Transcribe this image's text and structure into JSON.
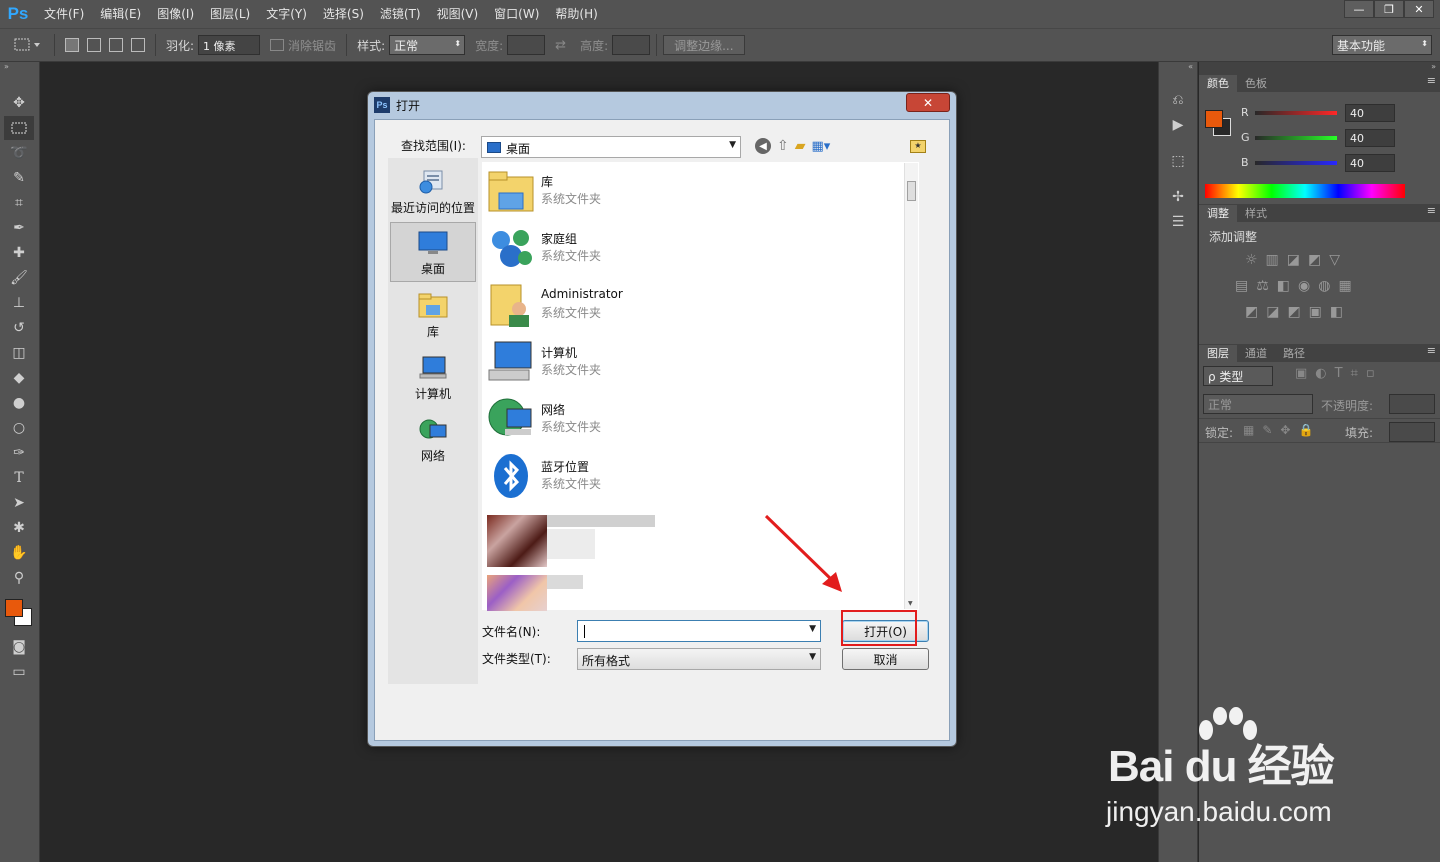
{
  "app": {
    "logo": "Ps",
    "menu": [
      "文件(F)",
      "编辑(E)",
      "图像(I)",
      "图层(L)",
      "文字(Y)",
      "选择(S)",
      "滤镜(T)",
      "视图(V)",
      "窗口(W)",
      "帮助(H)"
    ],
    "window_controls": [
      "—",
      "❐",
      "✕"
    ]
  },
  "options": {
    "feather_label": "羽化:",
    "feather_value": "1 像素",
    "antialias_label": "消除锯齿",
    "style_label": "样式:",
    "style_value": "正常",
    "width_label": "宽度:",
    "height_label": "高度:",
    "refine_edge": "调整边缘...",
    "workspace": "基本功能"
  },
  "panels": {
    "color_tabs": [
      "颜色",
      "色板"
    ],
    "rgb": [
      {
        "label": "R",
        "value": "40"
      },
      {
        "label": "G",
        "value": "40"
      },
      {
        "label": "B",
        "value": "40"
      }
    ],
    "adjust_tabs": [
      "调整",
      "样式"
    ],
    "add_adjustment": "添加调整",
    "layer_tabs": [
      "图层",
      "通道",
      "路径"
    ],
    "kind_label": "ρ 类型",
    "blend_mode": "正常",
    "opacity_label": "不透明度:",
    "lock_label": "锁定:",
    "fill_label": "填充:",
    "foreground_color": "#e8590c",
    "background_color": "#ffffff"
  },
  "dialog": {
    "title": "打开",
    "close": "✕",
    "look_in_label": "查找范围(I):",
    "look_in_value": "桌面",
    "places": [
      {
        "label": "最近访问的位置",
        "icon": "recent-places-icon"
      },
      {
        "label": "桌面",
        "icon": "desktop-icon"
      },
      {
        "label": "库",
        "icon": "library-icon"
      },
      {
        "label": "计算机",
        "icon": "computer-icon"
      },
      {
        "label": "网络",
        "icon": "network-icon"
      }
    ],
    "files": [
      {
        "name": "库",
        "type": "系统文件夹",
        "icon": "library-folder-icon"
      },
      {
        "name": "家庭组",
        "type": "系统文件夹",
        "icon": "homegroup-icon"
      },
      {
        "name": "Administrator",
        "type": "系统文件夹",
        "icon": "user-folder-icon"
      },
      {
        "name": "计算机",
        "type": "系统文件夹",
        "icon": "computer-icon"
      },
      {
        "name": "网络",
        "type": "系统文件夹",
        "icon": "network-icon"
      },
      {
        "name": "蓝牙位置",
        "type": "系统文件夹",
        "icon": "bluetooth-icon"
      }
    ],
    "filename_label": "文件名(N):",
    "filename_value": "",
    "filetype_label": "文件类型(T):",
    "filetype_value": "所有格式",
    "open_button": "打开(O)",
    "cancel_button": "取消"
  },
  "watermark": {
    "main": "Bai du 经验",
    "sub": "jingyan.baidu.com"
  }
}
